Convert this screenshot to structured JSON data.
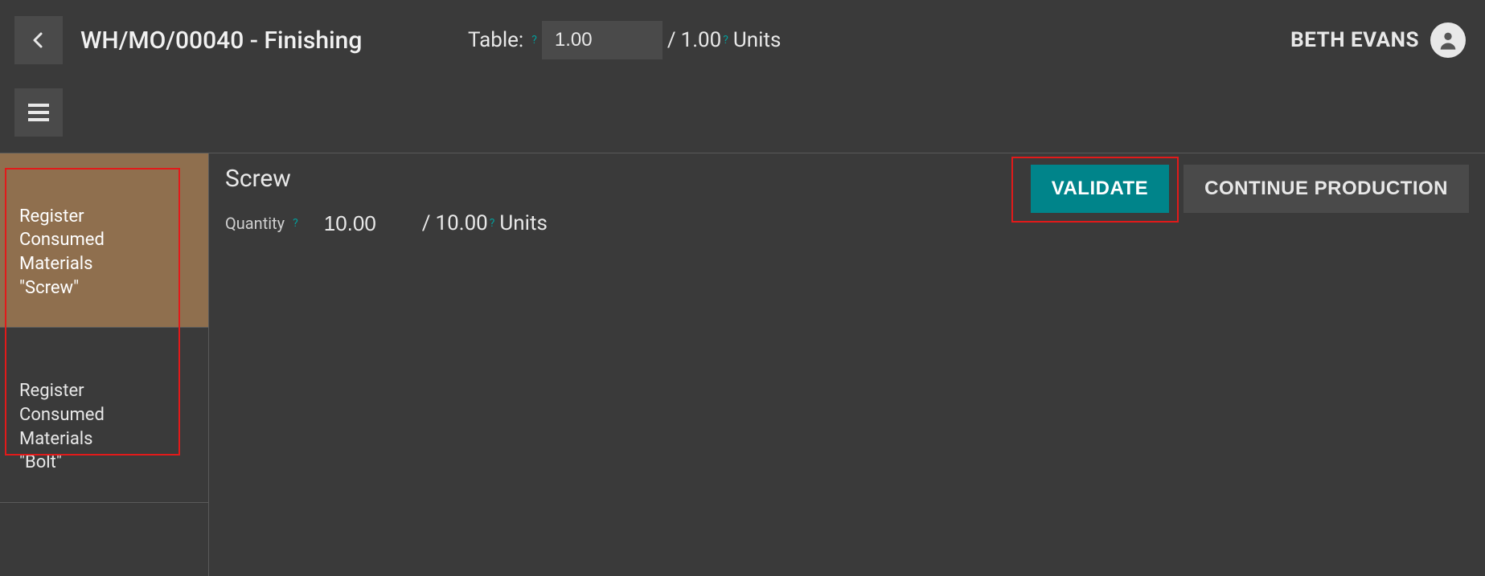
{
  "header": {
    "title": "WH/MO/00040 - Finishing",
    "table_label": "Table:",
    "table_value": "1.00",
    "table_sep": "/",
    "table_total": "1.00",
    "table_units": "Units",
    "user_name": "BETH EVANS"
  },
  "sidebar": {
    "items": [
      {
        "label": "Register\nConsumed\nMaterials\n\"Screw\"",
        "active": true
      },
      {
        "label": "Register\nConsumed\nMaterials\n\"Bolt\"",
        "active": false
      }
    ]
  },
  "main": {
    "product_name": "Screw",
    "qty_label": "Quantity",
    "qty_value": "10.00",
    "qty_sep": "/",
    "qty_total": "10.00",
    "qty_units": "Units"
  },
  "actions": {
    "validate": "VALIDATE",
    "continue": "CONTINUE PRODUCTION"
  }
}
